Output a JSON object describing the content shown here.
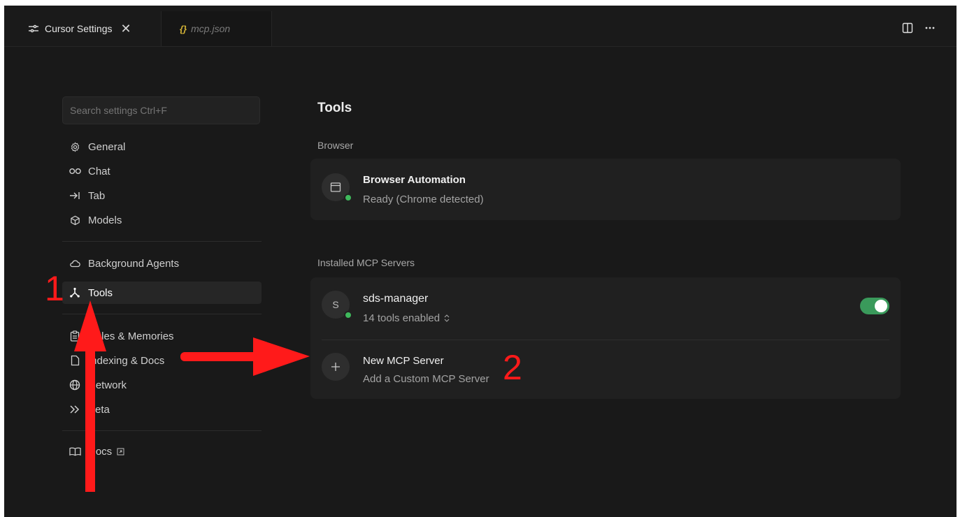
{
  "tabs": [
    {
      "label": "Cursor Settings",
      "icon": "settings-sliders-icon",
      "active": true
    },
    {
      "label": "mcp.json",
      "icon": "json-braces-icon",
      "active": false
    }
  ],
  "search": {
    "placeholder": "Search settings Ctrl+F"
  },
  "nav": {
    "items": [
      {
        "id": "general",
        "label": "General",
        "icon": "gear-icon"
      },
      {
        "id": "chat",
        "label": "Chat",
        "icon": "infinity-icon"
      },
      {
        "id": "tab",
        "label": "Tab",
        "icon": "arrow-right-bar-icon"
      },
      {
        "id": "models",
        "label": "Models",
        "icon": "cube-icon"
      },
      {
        "id": "background",
        "label": "Background Agents",
        "icon": "cloud-icon"
      },
      {
        "id": "tools",
        "label": "Tools",
        "icon": "tools-hub-icon",
        "active": true
      },
      {
        "id": "rules",
        "label": "Rules & Memories",
        "icon": "clipboard-icon"
      },
      {
        "id": "indexing",
        "label": "Indexing & Docs",
        "icon": "document-icon"
      },
      {
        "id": "network",
        "label": "Network",
        "icon": "globe-icon"
      },
      {
        "id": "beta",
        "label": "Beta",
        "icon": "double-chevron-icon"
      },
      {
        "id": "docs",
        "label": "Docs",
        "icon": "book-icon"
      }
    ]
  },
  "main": {
    "title": "Tools",
    "browser_section": "Browser",
    "browser_item": {
      "title": "Browser Automation",
      "subtitle": "Ready (Chrome detected)",
      "status": "green"
    },
    "mcp_section": "Installed MCP Servers",
    "mcp_server": {
      "avatar": "S",
      "title": "sds-manager",
      "subtitle": "14 tools enabled",
      "enabled": true
    },
    "new_server": {
      "title": "New MCP Server",
      "subtitle": "Add a Custom MCP Server"
    }
  },
  "annotations": {
    "step1": "1",
    "step2": "2",
    "color": "#ff1a1a"
  },
  "colors": {
    "accent_green": "#3fb95c",
    "toggle_on": "#3a9a5b",
    "background": "#191919"
  }
}
